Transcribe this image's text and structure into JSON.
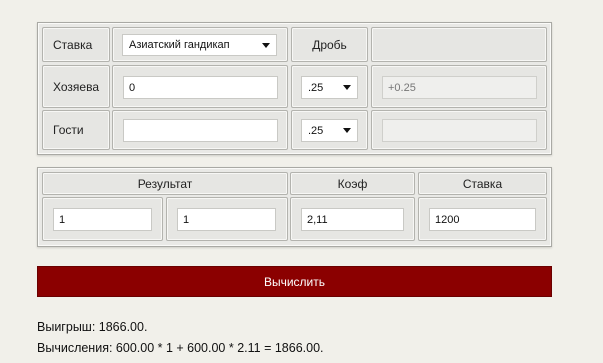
{
  "top": {
    "stake_label": "Ставка",
    "bet_type": "Азиатский гандикап",
    "fraction_label": "Дробь",
    "home_label": "Хозяева",
    "home_score": "0",
    "home_fraction": ".25",
    "home_handicap": "+0.25",
    "away_label": "Гости",
    "away_score": "",
    "away_fraction": ".25",
    "away_handicap": ""
  },
  "bottom": {
    "result_label": "Результат",
    "coef_label": "Коэф",
    "stake_label": "Ставка",
    "result_home": "1",
    "result_away": "1",
    "coef_value": "2,11",
    "stake_value": "1200"
  },
  "calculate_label": "Вычислить",
  "output": {
    "win": "Выигрыш: 1866.00.",
    "calc": "Вычисления: 600.00 * 1 + 600.00 * 2.11 = 1866.00."
  }
}
